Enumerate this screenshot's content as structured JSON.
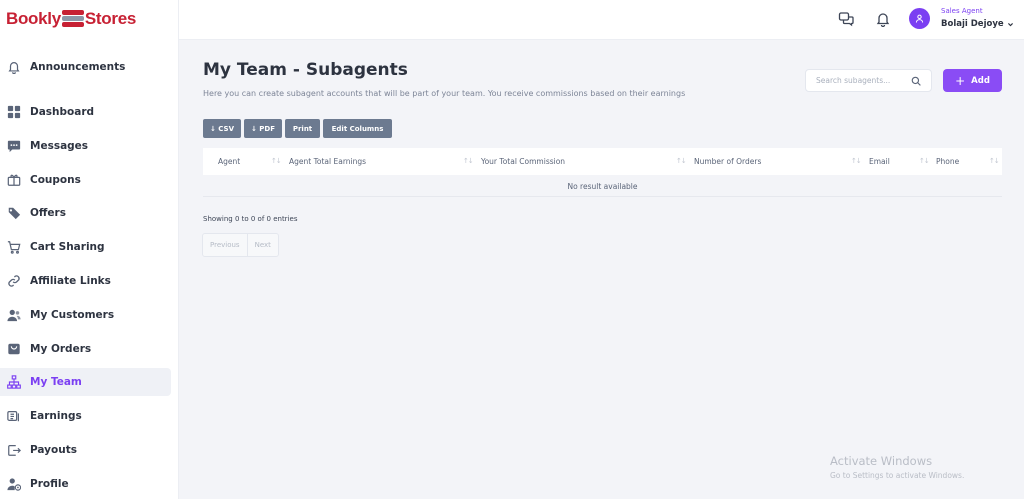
{
  "brand": {
    "name_left": "Bookly",
    "name_right": "Stores"
  },
  "sidebar": {
    "items": [
      {
        "label": "Announcements",
        "icon": "bell-icon"
      },
      {
        "label": "Dashboard",
        "icon": "dashboard-icon"
      },
      {
        "label": "Messages",
        "icon": "message-icon"
      },
      {
        "label": "Coupons",
        "icon": "coupon-icon"
      },
      {
        "label": "Offers",
        "icon": "offer-icon"
      },
      {
        "label": "Cart Sharing",
        "icon": "cart-icon"
      },
      {
        "label": "Affiliate Links",
        "icon": "link-icon"
      },
      {
        "label": "My Customers",
        "icon": "customers-icon"
      },
      {
        "label": "My Orders",
        "icon": "orders-icon"
      },
      {
        "label": "My Team",
        "icon": "team-icon",
        "active": true
      },
      {
        "label": "Earnings",
        "icon": "earnings-icon"
      },
      {
        "label": "Payouts",
        "icon": "payouts-icon"
      },
      {
        "label": "Profile",
        "icon": "profile-icon"
      }
    ]
  },
  "header": {
    "role": "Sales Agent",
    "user_name": "Bolaji Dejoye"
  },
  "main": {
    "title": "My Team - Subagents",
    "subtitle": "Here you can create subagent accounts that will be part of your team. You receive commissions based on their earnings",
    "search_placeholder": "Search subagents...",
    "add_label": "Add",
    "export_buttons": [
      "↓ CSV",
      "↓ PDF",
      "Print",
      "Edit Columns"
    ],
    "table": {
      "columns": [
        "Agent",
        "Agent Total Earnings",
        "Your Total Commission",
        "Number of Orders",
        "Email",
        "Phone"
      ],
      "empty_text": "No result available"
    },
    "entries_info": "Showing 0 to 0 of 0 entries",
    "pagination": {
      "previous": "Previous",
      "next": "Next"
    }
  },
  "watermark": {
    "title": "Activate Windows",
    "subtitle": "Go to Settings to activate Windows."
  },
  "colors": {
    "accent": "#8a4cf5",
    "brand": "#c72134",
    "export_button": "#6c7a90"
  }
}
